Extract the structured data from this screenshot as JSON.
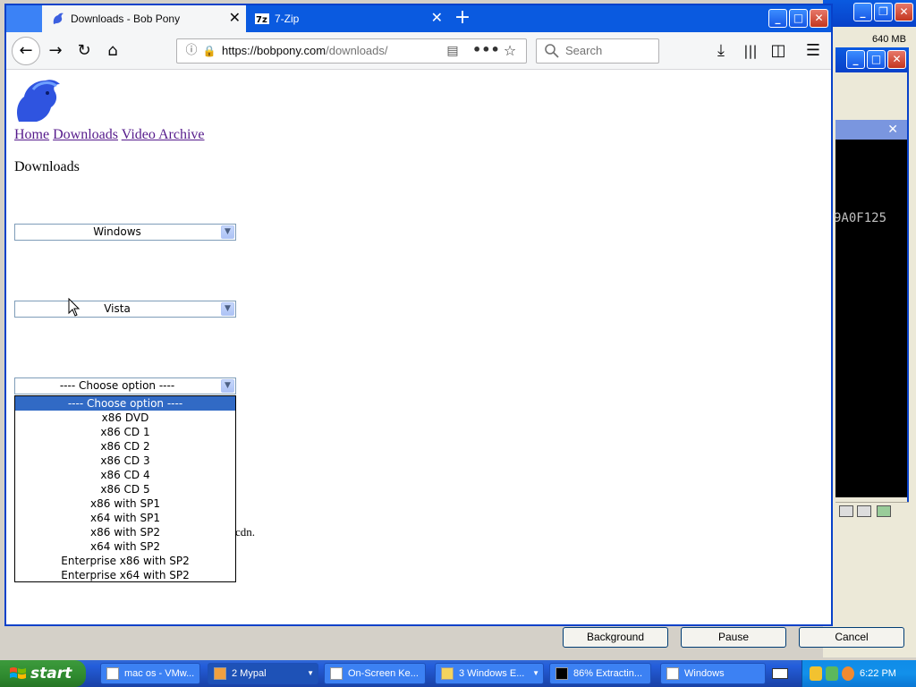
{
  "browser": {
    "tabs": [
      {
        "label": "Downloads - Bob Pony",
        "active": true
      },
      {
        "label": "7-Zip",
        "active": false
      }
    ],
    "url_domain": "https://bobpony.com",
    "url_path": "/downloads/",
    "search_placeholder": "Search"
  },
  "page": {
    "nav_links": [
      "Home",
      "Downloads",
      "Video Archive"
    ],
    "heading": "Downloads",
    "select_os": "Windows",
    "select_version": "Vista",
    "select_edition": "---- Choose option ----",
    "dropdown_options": [
      "---- Choose option ----",
      "x86 DVD",
      "x86 CD 1",
      "x86 CD 2",
      "x86 CD 3",
      "x86 CD 4",
      "x86 CD 5",
      "x86 with SP1",
      "x64 with SP1",
      "x86 with SP2",
      "x64 with SP2",
      "Enterprise x86 with SP2",
      "Enterprise x64 with SP2"
    ],
    "obscured_text": "cdn."
  },
  "background_app": {
    "memory_label": "640 MB",
    "console_text": "9A0F125",
    "buttons": {
      "background": "Background",
      "pause": "Pause",
      "cancel": "Cancel"
    }
  },
  "taskbar": {
    "start_label": "start",
    "items": [
      {
        "label": "mac os - VMw...",
        "active": false
      },
      {
        "label": "2 Mypal",
        "active": true
      },
      {
        "label": "On-Screen Ke...",
        "active": false
      },
      {
        "label": "3 Windows E...",
        "active": false
      },
      {
        "label": "86% Extractin...",
        "active": false
      },
      {
        "label": "Windows",
        "active": false
      }
    ],
    "clock": "6:22 PM"
  },
  "colors": {
    "xp_blue": "#0a5ae0",
    "link_visited": "#551a8b",
    "highlight": "#316ac5"
  }
}
